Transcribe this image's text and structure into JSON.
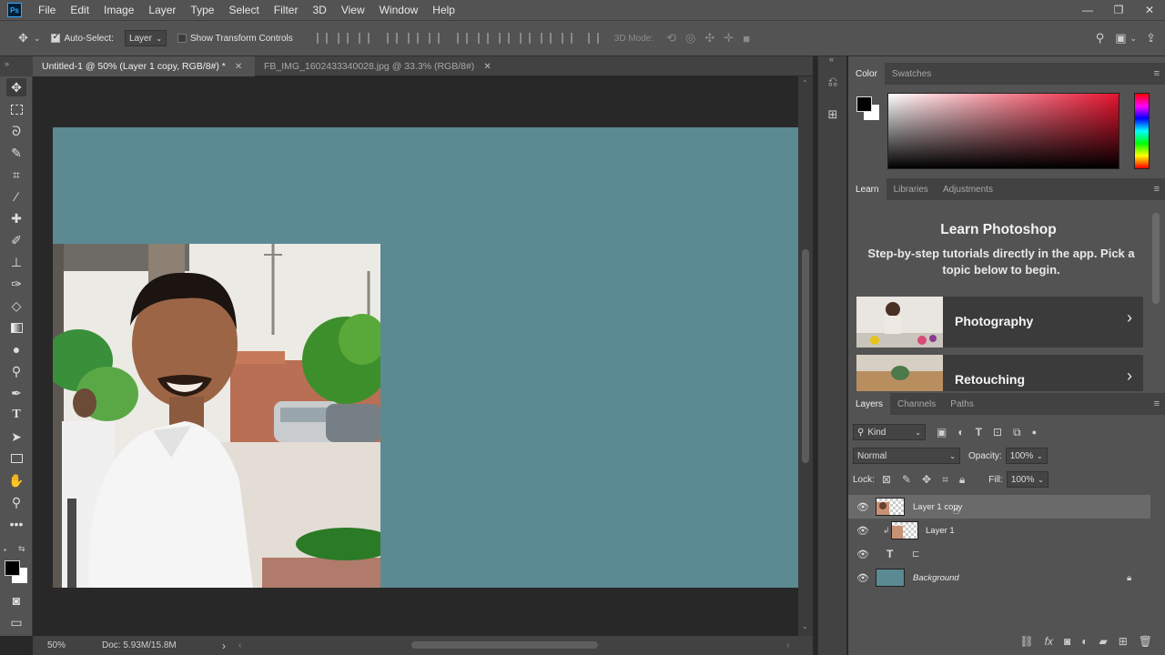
{
  "app": {
    "logo": "Ps"
  },
  "menu": [
    "File",
    "Edit",
    "Image",
    "Layer",
    "Type",
    "Select",
    "Filter",
    "3D",
    "View",
    "Window",
    "Help"
  ],
  "window_controls": {
    "minimize": "—",
    "restore": "❐",
    "close": "✕"
  },
  "options": {
    "auto_select_label": "Auto-Select:",
    "auto_select_checked": true,
    "auto_select_target": "Layer",
    "transform_controls_label": "Show Transform Controls",
    "mode_3d": "3D Mode:"
  },
  "tabs": [
    {
      "title": "Untitled-1 @ 50% (Layer 1 copy, RGB/8#) *",
      "close": "✕",
      "active": true
    },
    {
      "title": "FB_IMG_1602433340028.jpg @ 33.3% (RGB/8#)",
      "close": "✕",
      "active": false
    }
  ],
  "status": {
    "zoom": "50%",
    "doc": "Doc: 5.93M/15.8M",
    "arrow": "›"
  },
  "color_panel": {
    "tabs": [
      "Color",
      "Swatches"
    ],
    "foreground": "#000000",
    "background": "#ffffff"
  },
  "learn_panel": {
    "tabs": [
      "Learn",
      "Libraries",
      "Adjustments"
    ],
    "title": "Learn Photoshop",
    "description": "Step-by-step tutorials directly in the app. Pick a topic below to begin.",
    "cards": [
      {
        "label": "Photography"
      },
      {
        "label": "Retouching"
      }
    ]
  },
  "layers_panel": {
    "tabs": [
      "Layers",
      "Channels",
      "Paths"
    ],
    "filter_kind": "Kind",
    "blend_mode": "Normal",
    "opacity_label": "Opacity:",
    "opacity_value": "100%",
    "lock_label": "Lock:",
    "fill_label": "Fill:",
    "fill_value": "100%",
    "layers": [
      {
        "name": "Layer 1 copy",
        "selected": true
      },
      {
        "name": "Layer 1",
        "selected": false
      },
      {
        "name": "",
        "selected": false
      },
      {
        "name": "Background",
        "selected": false
      }
    ]
  },
  "colors": {
    "canvas_bg": "#5b8a92",
    "accent": "#31a8ff"
  }
}
